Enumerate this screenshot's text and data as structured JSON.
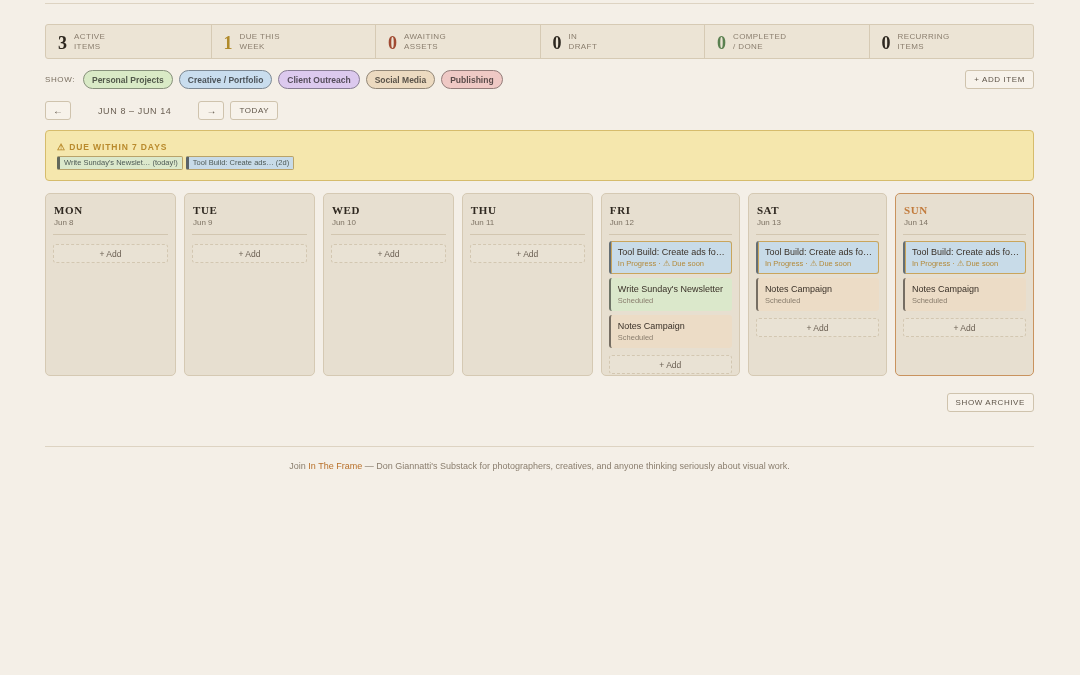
{
  "stats": [
    {
      "value": "3",
      "label": "ACTIVE\nITEMS",
      "color": "#2e2820"
    },
    {
      "value": "1",
      "label": "DUE THIS\nWEEK",
      "color": "#b08a2a"
    },
    {
      "value": "0",
      "label": "AWAITING\nASSETS",
      "color": "#a04a32"
    },
    {
      "value": "0",
      "label": "IN\nDRAFT",
      "color": "#2e2820"
    },
    {
      "value": "0",
      "label": "COMPLETED\n/ DONE",
      "color": "#5a8050"
    },
    {
      "value": "0",
      "label": "RECURRING\nITEMS",
      "color": "#2e2820"
    }
  ],
  "filter_label": "SHOW:",
  "filters": [
    {
      "label": "Personal Projects",
      "color": "#d9eac6"
    },
    {
      "label": "Creative / Portfolio",
      "color": "#c9ddee"
    },
    {
      "label": "Client Outreach",
      "color": "#dcc9ee"
    },
    {
      "label": "Social Media",
      "color": "#ecdac0"
    },
    {
      "label": "Publishing",
      "color": "#efc9c5"
    }
  ],
  "add_item": "+ ADD ITEM",
  "nav": {
    "prev": "←",
    "range": "JUN 8 – JUN 14",
    "next": "→",
    "today": "TODAY"
  },
  "due": {
    "title": "⚠ DUE WITHIN 7 DAYS",
    "chips": [
      {
        "label": "Write Sunday's Newslet… (today!)",
        "color": "#dbe8cb"
      },
      {
        "label": "Tool Build: Create ads… (2d)",
        "color": "#c8dbe8"
      }
    ]
  },
  "days": [
    {
      "name": "MON",
      "date": "Jun 8",
      "today": false,
      "add": "+ Add"
    },
    {
      "name": "TUE",
      "date": "Jun 9",
      "today": false,
      "add": "+ Add"
    },
    {
      "name": "WED",
      "date": "Jun 10",
      "today": false,
      "add": "+ Add"
    },
    {
      "name": "THU",
      "date": "Jun 11",
      "today": false,
      "add": "+ Add"
    },
    {
      "name": "FRI",
      "date": "Jun 12",
      "today": false,
      "items": [
        {
          "title": "Tool Build: Create ads fo…",
          "status": "In Progress · ⚠ Due soon",
          "color": "#c8dbe8",
          "due_soon": true
        },
        {
          "title": "Write Sunday's Newsletter",
          "status": "Scheduled",
          "color": "#dbe8cb",
          "due_soon": false
        },
        {
          "title": "Notes Campaign",
          "status": "Scheduled",
          "color": "#ecdcc6",
          "due_soon": false
        }
      ],
      "add": "+ Add"
    },
    {
      "name": "SAT",
      "date": "Jun 13",
      "today": false,
      "items": [
        {
          "title": "Tool Build: Create ads fo…",
          "status": "In Progress · ⚠ Due soon",
          "color": "#c8dbe8",
          "due_soon": true
        },
        {
          "title": "Notes Campaign",
          "status": "Scheduled",
          "color": "#ecdcc6",
          "due_soon": false
        }
      ],
      "add": "+ Add"
    },
    {
      "name": "SUN",
      "date": "Jun 14",
      "today": true,
      "items": [
        {
          "title": "Tool Build: Create ads fo…",
          "status": "In Progress · ⚠ Due soon",
          "color": "#c8dbe8",
          "due_soon": true
        },
        {
          "title": "Notes Campaign",
          "status": "Scheduled",
          "color": "#ecdcc6",
          "due_soon": false
        }
      ],
      "add": "+ Add"
    }
  ],
  "archive": "SHOW ARCHIVE",
  "footer": {
    "before": "Join",
    "link": "In The Frame",
    "after": "— Don Giannatti's Substack for photographers, creatives, and anyone thinking seriously about visual work."
  }
}
